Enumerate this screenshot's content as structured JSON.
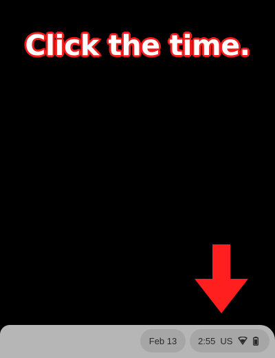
{
  "instruction": {
    "text": "Click the time.",
    "text_color": "#ffffff",
    "outline_color": "#ee1c1c"
  },
  "pointer": {
    "icon": "down-arrow-icon",
    "color": "#ff1f1f"
  },
  "shelf": {
    "date_label": "Feb 13",
    "time_label": "2:55",
    "locale_label": "US",
    "wifi_icon": "wifi-icon",
    "battery_icon": "battery-icon",
    "background_color": "#b6b6b6",
    "pill_color": "#a6a6a6"
  }
}
